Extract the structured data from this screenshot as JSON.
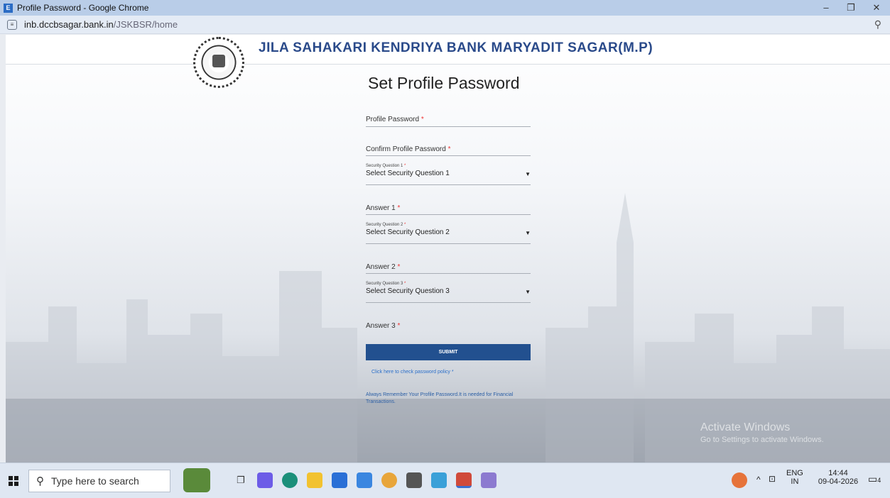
{
  "window": {
    "title": "Profile Password - Google Chrome",
    "minimize": "–",
    "maximize": "❐",
    "close": "✕"
  },
  "browser": {
    "url_host": "inb.dccbsagar.bank.in",
    "url_path": "/JSKBSR/home"
  },
  "header": {
    "bank_name": "JILA SAHAKARI KENDRIYA BANK MARYADIT SAGAR(M.P)"
  },
  "form": {
    "title": "Set Profile Password",
    "profile_password_label": "Profile Password",
    "confirm_password_label": "Confirm Profile Password",
    "sq1_small": "Security Question 1",
    "sq1_value": "Select Security Question 1",
    "answer1_label": "Answer 1",
    "sq2_small": "Security Question 2",
    "sq2_value": "Select Security Question 2",
    "answer2_label": "Answer 2",
    "sq3_small": "Security Question 3",
    "sq3_value": "Select Security Question 3",
    "answer3_label": "Answer 3",
    "required_mark": "*",
    "submit_label": "SUBMIT",
    "policy_link": "Click here to check password policy *",
    "note": "Always Remember Your Profile Password.It is needed for Financial Transactions."
  },
  "watermark": {
    "line1": "Activate Windows",
    "line2": "Go to Settings to activate Windows."
  },
  "taskbar": {
    "search_placeholder": "Type here to search",
    "lang_top": "ENG",
    "lang_bottom": "IN",
    "time": "14:44",
    "date": "09-04-2026",
    "notification_count": "4"
  }
}
